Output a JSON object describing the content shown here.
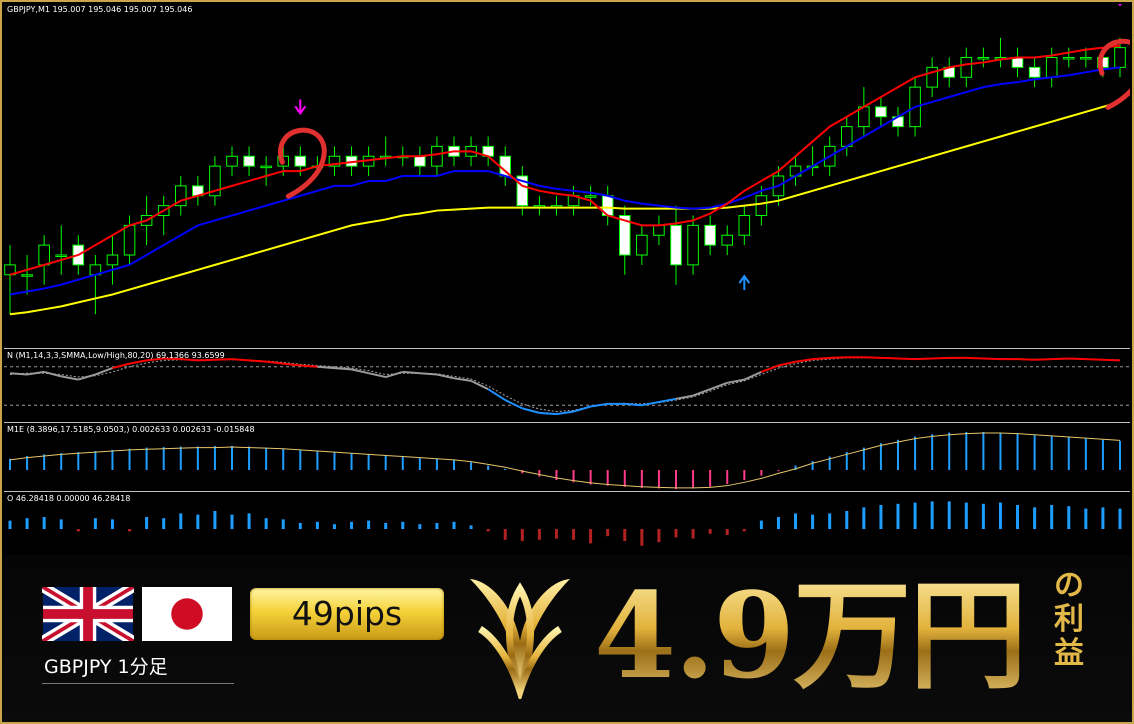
{
  "chart_header": {
    "label": "GBPJPY,M1  195.007 195.046 195.007 195.046"
  },
  "indicators": {
    "stoch_label": "N (M1,14,3,3,SMMA,Low/High,80,20) 69.1366 93.6599",
    "macd_label": "M1E (8.3896,17.5185,9.0503,) 0.002633 0.002633 -0.015848",
    "osc_label": "O 46.28418 0.00000 46.28418"
  },
  "banner": {
    "pair": "GBPJPY  1分足",
    "pips": "49pips",
    "profit": "4.9万円",
    "suffix": [
      "の",
      "利",
      "益"
    ]
  },
  "icons": [
    "uk-flag-icon",
    "japan-flag-icon",
    "logo-icon",
    "sell-arrow-icon",
    "buy-arrow-icon",
    "signal-circle-icon"
  ],
  "colors": {
    "bull_candle": "#00ff00",
    "bear_candle": "#ffffff",
    "ma_fast": "#ff0000",
    "ma_mid": "#0000ff",
    "ma_slow": "#ffff00",
    "stoch_main": "#ff0000",
    "stoch_low": "#1e90ff",
    "macd_up": "#1e9fff",
    "macd_down": "#ff3b8a",
    "osc_up": "#1e9fff",
    "osc_down": "#b22222",
    "signal_sell": "#ff00ff",
    "signal_buy": "#1e90ff",
    "accent_gold": "#e2b848"
  },
  "chart_data": {
    "type": "candlestick",
    "symbol": "GBPJPY",
    "timeframe": "M1",
    "candles": [
      [
        194.9,
        194.93,
        194.86,
        194.91
      ],
      [
        194.9,
        194.92,
        194.88,
        194.9
      ],
      [
        194.91,
        194.94,
        194.89,
        194.93
      ],
      [
        194.92,
        194.95,
        194.9,
        194.92
      ],
      [
        194.93,
        194.94,
        194.9,
        194.91
      ],
      [
        194.9,
        194.92,
        194.86,
        194.91
      ],
      [
        194.91,
        194.94,
        194.89,
        194.92
      ],
      [
        194.92,
        194.96,
        194.91,
        194.95
      ],
      [
        194.95,
        194.98,
        194.93,
        194.96
      ],
      [
        194.96,
        194.98,
        194.94,
        194.97
      ],
      [
        194.97,
        195.0,
        194.96,
        194.99
      ],
      [
        194.99,
        195.0,
        194.97,
        194.98
      ],
      [
        194.98,
        195.02,
        194.97,
        195.01
      ],
      [
        195.01,
        195.03,
        195.0,
        195.02
      ],
      [
        195.02,
        195.03,
        195.0,
        195.01
      ],
      [
        195.01,
        195.02,
        194.99,
        195.01
      ],
      [
        195.01,
        195.03,
        195.0,
        195.02
      ],
      [
        195.02,
        195.03,
        195.0,
        195.01
      ],
      [
        195.01,
        195.02,
        195.0,
        195.01
      ],
      [
        195.01,
        195.03,
        195.0,
        195.02
      ],
      [
        195.02,
        195.03,
        195.0,
        195.01
      ],
      [
        195.01,
        195.03,
        195.0,
        195.02
      ],
      [
        195.02,
        195.04,
        195.01,
        195.02
      ],
      [
        195.02,
        195.03,
        195.01,
        195.02
      ],
      [
        195.02,
        195.03,
        195.0,
        195.01
      ],
      [
        195.01,
        195.04,
        195.0,
        195.03
      ],
      [
        195.03,
        195.04,
        195.01,
        195.02
      ],
      [
        195.02,
        195.04,
        195.01,
        195.03
      ],
      [
        195.03,
        195.04,
        195.01,
        195.02
      ],
      [
        195.02,
        195.03,
        194.99,
        195.0
      ],
      [
        195.0,
        195.01,
        194.96,
        194.97
      ],
      [
        194.97,
        194.98,
        194.96,
        194.97
      ],
      [
        194.97,
        194.98,
        194.96,
        194.97
      ],
      [
        194.97,
        194.99,
        194.96,
        194.98
      ],
      [
        194.98,
        194.99,
        194.97,
        194.98
      ],
      [
        194.98,
        194.99,
        194.95,
        194.96
      ],
      [
        194.96,
        194.97,
        194.9,
        194.92
      ],
      [
        194.92,
        194.95,
        194.91,
        194.94
      ],
      [
        194.94,
        194.96,
        194.93,
        194.95
      ],
      [
        194.95,
        194.97,
        194.89,
        194.91
      ],
      [
        194.91,
        194.96,
        194.9,
        194.95
      ],
      [
        194.95,
        194.96,
        194.92,
        194.93
      ],
      [
        194.93,
        194.95,
        194.92,
        194.94
      ],
      [
        194.94,
        194.97,
        194.93,
        194.96
      ],
      [
        194.96,
        194.99,
        194.95,
        194.98
      ],
      [
        194.98,
        195.01,
        194.97,
        195.0
      ],
      [
        195.0,
        195.02,
        194.99,
        195.01
      ],
      [
        195.01,
        195.03,
        195.0,
        195.01
      ],
      [
        195.01,
        195.04,
        195.0,
        195.03
      ],
      [
        195.03,
        195.06,
        195.02,
        195.05
      ],
      [
        195.05,
        195.09,
        195.04,
        195.07
      ],
      [
        195.07,
        195.08,
        195.05,
        195.06
      ],
      [
        195.06,
        195.07,
        195.04,
        195.05
      ],
      [
        195.05,
        195.1,
        195.04,
        195.09
      ],
      [
        195.09,
        195.12,
        195.08,
        195.11
      ],
      [
        195.11,
        195.12,
        195.09,
        195.1
      ],
      [
        195.1,
        195.13,
        195.09,
        195.12
      ],
      [
        195.12,
        195.13,
        195.11,
        195.12
      ],
      [
        195.12,
        195.14,
        195.11,
        195.12
      ],
      [
        195.12,
        195.13,
        195.1,
        195.11
      ],
      [
        195.11,
        195.12,
        195.09,
        195.1
      ],
      [
        195.1,
        195.13,
        195.09,
        195.12
      ],
      [
        195.12,
        195.13,
        195.11,
        195.12
      ],
      [
        195.12,
        195.13,
        195.11,
        195.12
      ],
      [
        195.12,
        195.13,
        195.1,
        195.11
      ],
      [
        195.11,
        195.14,
        195.1,
        195.13
      ]
    ],
    "ma_fast": [
      194.9,
      194.905,
      194.91,
      194.915,
      194.92,
      194.93,
      194.94,
      194.95,
      194.955,
      194.965,
      194.975,
      194.98,
      194.985,
      194.99,
      194.995,
      195.0,
      195.005,
      195.005,
      195.01,
      195.012,
      195.014,
      195.016,
      195.018,
      195.02,
      195.02,
      195.022,
      195.025,
      195.025,
      195.02,
      195.005,
      194.99,
      194.985,
      194.982,
      194.98,
      194.975,
      194.96,
      194.955,
      194.95,
      194.95,
      194.952,
      194.955,
      194.962,
      194.972,
      194.985,
      194.995,
      195.005,
      195.02,
      195.035,
      195.05,
      195.06,
      195.07,
      195.08,
      195.09,
      195.1,
      195.105,
      195.11,
      195.113,
      195.115,
      195.118,
      195.12,
      195.12,
      195.122,
      195.125,
      195.128,
      195.13,
      195.132
    ],
    "ma_mid": [
      194.88,
      194.883,
      194.886,
      194.89,
      194.895,
      194.9,
      194.905,
      194.91,
      194.92,
      194.93,
      194.94,
      194.95,
      194.955,
      194.96,
      194.965,
      194.97,
      194.975,
      194.98,
      194.985,
      194.99,
      194.99,
      194.995,
      194.995,
      195.0,
      195.0,
      195.0,
      195.005,
      195.005,
      195.005,
      195.0,
      194.995,
      194.99,
      194.987,
      194.985,
      194.983,
      194.98,
      194.975,
      194.972,
      194.97,
      194.968,
      194.967,
      194.968,
      194.972,
      194.978,
      194.985,
      194.99,
      195.0,
      195.01,
      195.02,
      195.03,
      195.04,
      195.05,
      195.06,
      195.07,
      195.075,
      195.08,
      195.085,
      195.09,
      195.093,
      195.095,
      195.098,
      195.1,
      195.102,
      195.105,
      195.108,
      195.11
    ],
    "ma_slow": [
      194.86,
      194.862,
      194.865,
      194.868,
      194.872,
      194.876,
      194.88,
      194.885,
      194.89,
      194.895,
      194.9,
      194.905,
      194.91,
      194.915,
      194.92,
      194.925,
      194.93,
      194.935,
      194.94,
      194.945,
      194.95,
      194.953,
      194.956,
      194.96,
      194.962,
      194.965,
      194.966,
      194.967,
      194.968,
      194.968,
      194.968,
      194.968,
      194.968,
      194.968,
      194.968,
      194.968,
      194.967,
      194.967,
      194.967,
      194.967,
      194.967,
      194.967,
      194.968,
      194.97,
      194.972,
      194.975,
      194.98,
      194.985,
      194.99,
      194.995,
      195.0,
      195.005,
      195.01,
      195.015,
      195.02,
      195.025,
      195.03,
      195.035,
      195.04,
      195.045,
      195.05,
      195.055,
      195.06,
      195.065,
      195.07,
      195.075
    ],
    "ylim": [
      194.84,
      195.16
    ],
    "sell_signals": [
      17,
      65
    ],
    "buy_signals": [
      43
    ],
    "stochastic": {
      "levels": [
        80,
        20
      ],
      "main": [
        70,
        68,
        72,
        65,
        60,
        68,
        78,
        85,
        90,
        93,
        92,
        90,
        91,
        92,
        90,
        88,
        85,
        82,
        80,
        78,
        76,
        70,
        64,
        72,
        70,
        68,
        62,
        58,
        45,
        28,
        15,
        8,
        6,
        10,
        18,
        22,
        22,
        20,
        25,
        30,
        35,
        45,
        55,
        60,
        72,
        82,
        88,
        92,
        94,
        95,
        95,
        94,
        93,
        92,
        93,
        94,
        94,
        93,
        92,
        92,
        91,
        92,
        93,
        92,
        91,
        90
      ],
      "signal": [
        68,
        70,
        70,
        68,
        64,
        66,
        72,
        80,
        86,
        90,
        91,
        91,
        91,
        91,
        90,
        89,
        87,
        84,
        82,
        80,
        78,
        74,
        68,
        70,
        70,
        69,
        65,
        61,
        50,
        35,
        22,
        14,
        10,
        12,
        18,
        22,
        23,
        22,
        24,
        28,
        33,
        42,
        52,
        58,
        68,
        78,
        85,
        90,
        92,
        94,
        94,
        94,
        93,
        93,
        93,
        93,
        94,
        93,
        93,
        92,
        92,
        92,
        92,
        92,
        91,
        91
      ]
    },
    "macd": {
      "hist": [
        0.02,
        0.025,
        0.028,
        0.03,
        0.032,
        0.034,
        0.036,
        0.038,
        0.04,
        0.041,
        0.042,
        0.042,
        0.043,
        0.043,
        0.042,
        0.04,
        0.038,
        0.036,
        0.034,
        0.032,
        0.03,
        0.028,
        0.025,
        0.024,
        0.022,
        0.02,
        0.018,
        0.014,
        0.008,
        0.002,
        -0.006,
        -0.012,
        -0.018,
        -0.022,
        -0.026,
        -0.028,
        -0.03,
        -0.032,
        -0.033,
        -0.034,
        -0.033,
        -0.03,
        -0.025,
        -0.018,
        -0.01,
        -0.002,
        0.008,
        0.016,
        0.024,
        0.032,
        0.04,
        0.048,
        0.054,
        0.06,
        0.064,
        0.067,
        0.068,
        0.068,
        0.067,
        0.065,
        0.062,
        0.06,
        0.058,
        0.056,
        0.054,
        0.052
      ],
      "signal": [
        0.018,
        0.022,
        0.025,
        0.028,
        0.03,
        0.032,
        0.034,
        0.036,
        0.037,
        0.038,
        0.039,
        0.04,
        0.04,
        0.041,
        0.04,
        0.039,
        0.038,
        0.036,
        0.034,
        0.032,
        0.03,
        0.028,
        0.026,
        0.024,
        0.022,
        0.02,
        0.018,
        0.015,
        0.01,
        0.005,
        -0.002,
        -0.008,
        -0.014,
        -0.019,
        -0.023,
        -0.026,
        -0.028,
        -0.03,
        -0.031,
        -0.032,
        -0.032,
        -0.031,
        -0.028,
        -0.022,
        -0.015,
        -0.006,
        0.002,
        0.012,
        0.02,
        0.028,
        0.036,
        0.044,
        0.05,
        0.056,
        0.06,
        0.063,
        0.065,
        0.066,
        0.066,
        0.065,
        0.063,
        0.061,
        0.059,
        0.057,
        0.055,
        0.053
      ]
    },
    "oscillator": {
      "values": [
        14,
        18,
        20,
        16,
        -4,
        18,
        16,
        -4,
        20,
        18,
        26,
        24,
        30,
        24,
        26,
        18,
        16,
        10,
        12,
        8,
        12,
        14,
        10,
        12,
        8,
        10,
        12,
        6,
        -4,
        -18,
        -20,
        -18,
        -16,
        -18,
        -24,
        -12,
        -20,
        -28,
        -22,
        -14,
        -16,
        -8,
        -10,
        -4,
        14,
        20,
        26,
        24,
        26,
        30,
        36,
        40,
        42,
        44,
        46,
        46,
        44,
        42,
        44,
        40,
        36,
        40,
        38,
        34,
        36,
        34
      ]
    }
  }
}
